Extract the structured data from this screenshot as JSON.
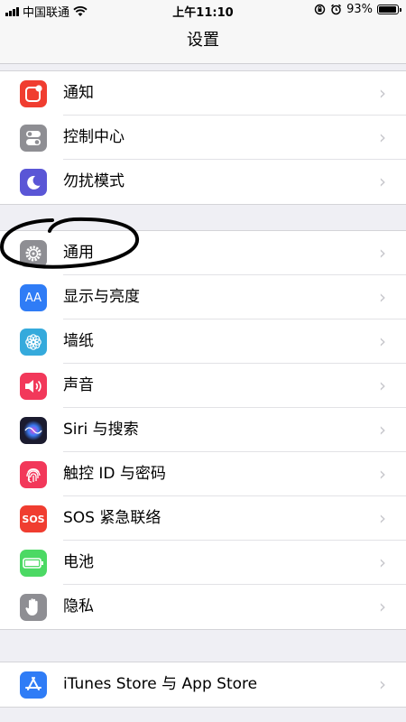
{
  "status_bar": {
    "carrier": "中国联通",
    "time": "上午11:10",
    "battery": "93%",
    "battery_level": 0.93
  },
  "nav": {
    "title": "设置"
  },
  "groups": [
    {
      "items": [
        {
          "name": "notifications",
          "label": "通知",
          "icon": "notification-icon",
          "color": "#f03d30"
        },
        {
          "name": "control-center",
          "label": "控制中心",
          "icon": "toggles-icon",
          "color": "#8e8e93"
        },
        {
          "name": "do-not-disturb",
          "label": "勿扰模式",
          "icon": "moon-icon",
          "color": "#5a56d6"
        }
      ]
    },
    {
      "items": [
        {
          "name": "general",
          "label": "通用",
          "icon": "gear-icon",
          "color": "#8e8e93"
        },
        {
          "name": "display-brightness",
          "label": "显示与亮度",
          "icon": "text-size-icon",
          "color": "#2f7cf6"
        },
        {
          "name": "wallpaper",
          "label": "墙纸",
          "icon": "flower-icon",
          "color": "#35aadc"
        },
        {
          "name": "sounds",
          "label": "声音",
          "icon": "speaker-icon",
          "color": "#f2385a"
        },
        {
          "name": "siri-search",
          "label": "Siri 与搜索",
          "icon": "siri-icon",
          "color": "#1b1b2f"
        },
        {
          "name": "touch-id-passcode",
          "label": "触控 ID 与密码",
          "icon": "fingerprint-icon",
          "color": "#f2385a"
        },
        {
          "name": "emergency-sos",
          "label": "SOS 紧急联络",
          "icon": "sos-icon",
          "color": "#f03d30"
        },
        {
          "name": "battery",
          "label": "电池",
          "icon": "battery-icon",
          "color": "#4cd964"
        },
        {
          "name": "privacy",
          "label": "隐私",
          "icon": "hand-icon",
          "color": "#8e8e93"
        }
      ]
    },
    {
      "items": [
        {
          "name": "itunes-app-store",
          "label": "iTunes Store 与 App Store",
          "icon": "app-store-icon",
          "color": "#2f7cf6"
        }
      ]
    }
  ],
  "icon_text": {
    "sos": "SOS",
    "aa": "AA"
  }
}
